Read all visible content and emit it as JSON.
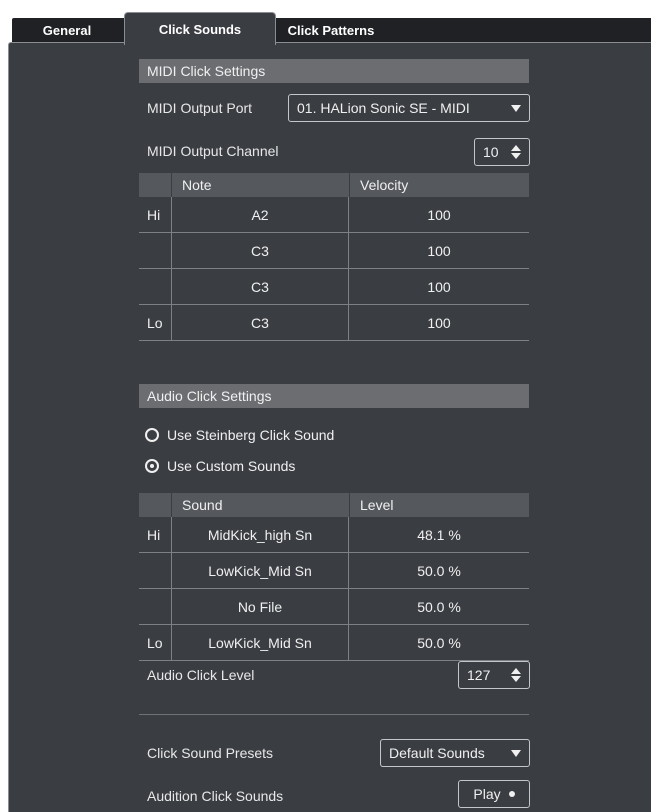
{
  "tabs": [
    {
      "label": "General",
      "active": false
    },
    {
      "label": "Click Sounds",
      "active": true
    },
    {
      "label": "Click Patterns",
      "active": false
    }
  ],
  "midi": {
    "header": "MIDI Click Settings",
    "output_port_label": "MIDI Output Port",
    "output_port_value": "01. HALion Sonic SE - MIDI",
    "output_channel_label": "MIDI Output Channel",
    "output_channel_value": "10",
    "table": {
      "columns": [
        "",
        "Note",
        "Velocity"
      ],
      "rows": [
        {
          "tag": "Hi",
          "note": "A2",
          "velocity": "100"
        },
        {
          "tag": "",
          "note": "C3",
          "velocity": "100"
        },
        {
          "tag": "",
          "note": "C3",
          "velocity": "100"
        },
        {
          "tag": "Lo",
          "note": "C3",
          "velocity": "100"
        }
      ]
    }
  },
  "audio": {
    "header": "Audio Click Settings",
    "radio_steinberg": "Use Steinberg Click Sound",
    "radio_custom": "Use Custom Sounds",
    "selected": "custom",
    "table": {
      "columns": [
        "",
        "Sound",
        "Level"
      ],
      "rows": [
        {
          "tag": "Hi",
          "sound": "MidKick_high Sn",
          "level": "48.1 %"
        },
        {
          "tag": "",
          "sound": "LowKick_Mid Sn",
          "level": "50.0 %"
        },
        {
          "tag": "",
          "sound": "No File",
          "level": "50.0 %"
        },
        {
          "tag": "Lo",
          "sound": "LowKick_Mid Sn",
          "level": "50.0 %"
        }
      ]
    },
    "click_level_label": "Audio Click Level",
    "click_level_value": "127"
  },
  "presets": {
    "label": "Click Sound Presets",
    "value": "Default Sounds"
  },
  "audition": {
    "label": "Audition Click Sounds",
    "button": "Play"
  },
  "colors": {
    "panel": "#3a3d42",
    "section_header": "#6b6d71",
    "tab_strip": "#1f2125"
  }
}
